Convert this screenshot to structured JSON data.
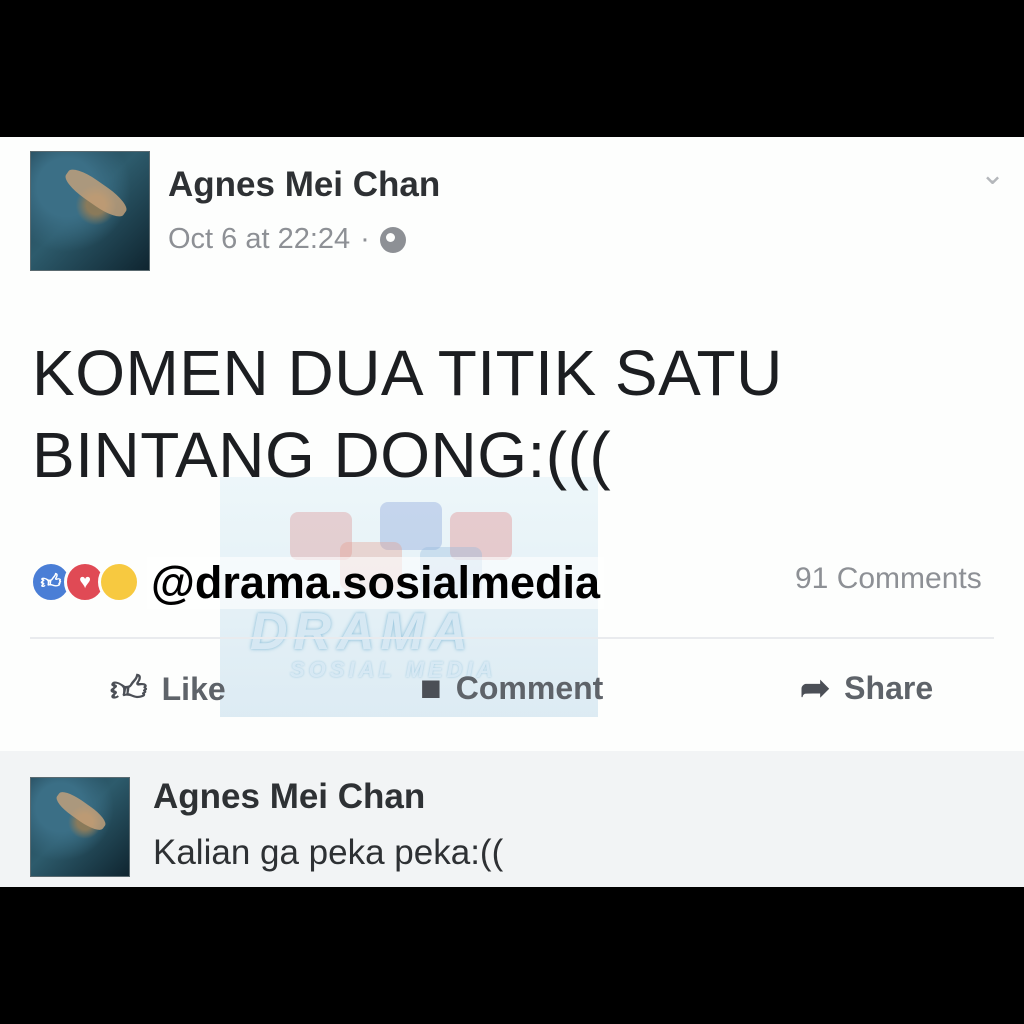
{
  "post": {
    "author": "Agnes Mei Chan",
    "timestamp": "Oct 6 at 22:24",
    "separator": "·",
    "privacy_icon": "globe-icon",
    "menu_icon": "chevron-down-icon",
    "text_line1": "KOMEN DUA TITIK SATU",
    "text_line2": "BINTANG DONG:((("
  },
  "reactions": {
    "types": [
      "like-icon",
      "love-icon",
      "haha-icon"
    ],
    "comments_count": "91 Comments"
  },
  "overlay": {
    "handle": "@drama.sosialmedia",
    "watermark_title": "DRAMA",
    "watermark_subtitle": "SOSIAL MEDIA"
  },
  "actions": {
    "like_label": "Like",
    "comment_label": "Comment",
    "share_label": "Share"
  },
  "comment": {
    "author": "Agnes Mei Chan",
    "text": "Kalian ga peka peka:(("
  },
  "colors": {
    "background": "#000000",
    "card": "#fdfefd",
    "like_blue": "#4a7ed6",
    "love_red": "#e04a55",
    "text_dark": "#1c1e21",
    "text_muted": "#8d9095"
  }
}
